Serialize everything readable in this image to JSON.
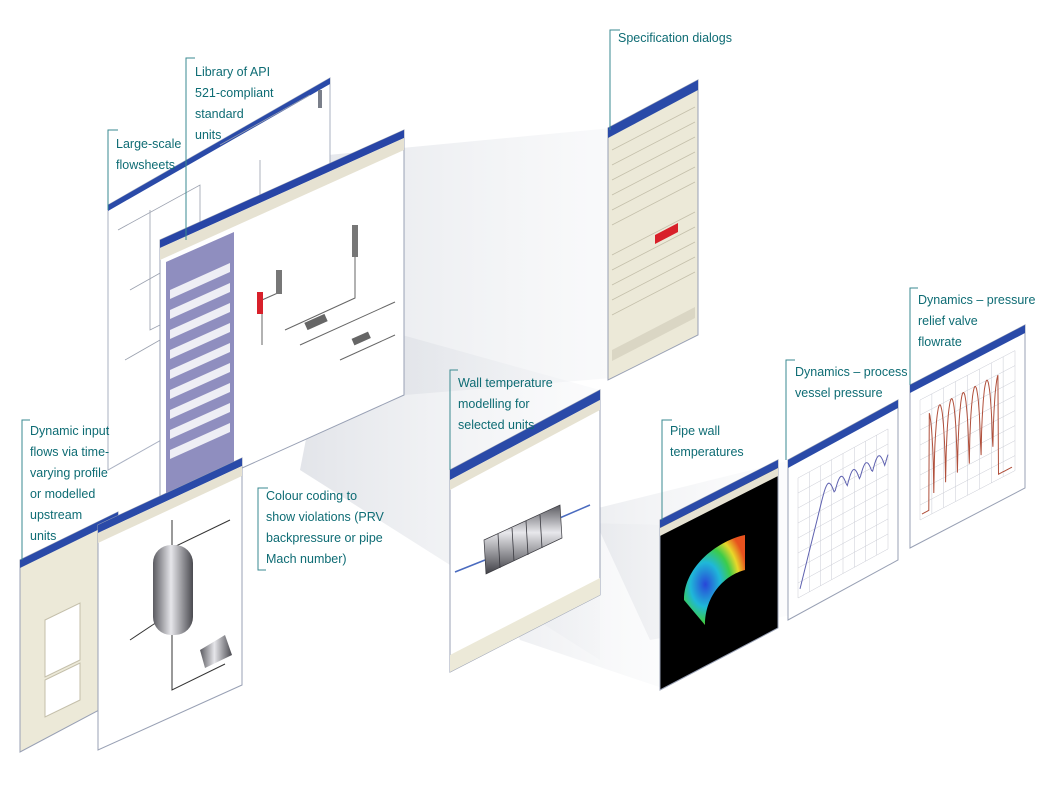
{
  "callouts": {
    "large_scale": "Large-scale\nflowsheets",
    "library": "Library of API\n521-compliant\nstandard\nunits",
    "specification": "Specification dialogs",
    "dynamic_input": "Dynamic input\nflows via time-\nvarying profile\nor modelled\nupstream\nunits",
    "colour_coding": "Colour coding to\nshow violations (PRV\nbackpressure or pipe\nMach number)",
    "wall_temp": "Wall temperature\nmodelling for\nselected units",
    "pipe_wall": "Pipe wall\ntemperatures",
    "dyn_vessel": "Dynamics – process\nvessel pressure",
    "dyn_prv": "Dynamics – pressure\nrelief valve\nflowrate"
  },
  "colors": {
    "callout_text": "#0e6c74",
    "callout_line": "#3a8a90",
    "titlebar": "#1b3b9e",
    "violation": "#d8202a",
    "pressure_series": "#5f62b0",
    "flow_series": "#b0503c"
  }
}
